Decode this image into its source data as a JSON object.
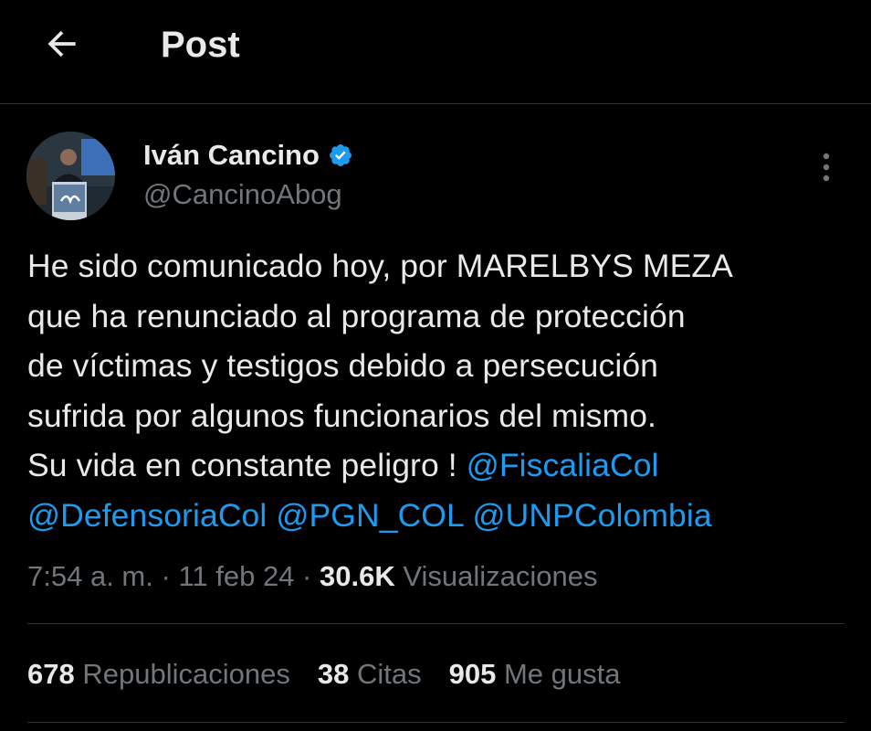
{
  "header": {
    "title": "Post",
    "back_icon": "arrow-left-icon"
  },
  "post": {
    "author": {
      "name": "Iván Cancino",
      "handle": "@CancinoAbog",
      "verified": true,
      "verified_color": "#1d9bf0"
    },
    "text_lines": [
      [
        {
          "text": "He sido comunicado hoy, por MARELBYS MEZA"
        }
      ],
      [
        {
          "text": "que ha renunciado al programa de protección"
        }
      ],
      [
        {
          "text": "de víctimas y testigos debido a persecución"
        }
      ],
      [
        {
          "text": "sufrida por algunos funcionarios del mismo."
        }
      ],
      [
        {
          "text": "Su vida en constante peligro ! "
        },
        {
          "text": "@FiscaliaCol",
          "mention": true
        }
      ],
      [
        {
          "text": "@DefensoriaCol",
          "mention": true
        },
        {
          "text": " "
        },
        {
          "text": "@PGN_COL",
          "mention": true
        },
        {
          "text": " "
        },
        {
          "text": "@UNPColombia",
          "mention": true
        }
      ]
    ],
    "time": "7:54 a. m.",
    "separator": "·",
    "date": "11 feb 24",
    "views_count": "30.6K",
    "views_label": "Visualizaciones"
  },
  "stats": {
    "reposts_count": "678",
    "reposts_label": "Republicaciones",
    "quotes_count": "38",
    "quotes_label": "Citas",
    "likes_count": "905",
    "likes_label": "Me gusta"
  },
  "colors": {
    "background": "#000000",
    "text_primary": "#e7e9ea",
    "text_secondary": "#71767b",
    "link": "#1d9bf0",
    "divider": "#2f3336"
  }
}
